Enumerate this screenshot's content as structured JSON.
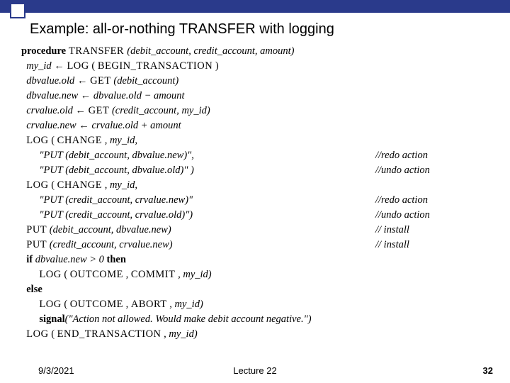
{
  "title": "Example: all-or-nothing TRANSFER with logging",
  "footer": {
    "date": "9/3/2021",
    "lecture": "Lecture 22",
    "page": "32"
  },
  "code": {
    "l1_a": "procedure",
    "l1_b": " TRANSFER ",
    "l1_c": "(debit_account, credit_account, amount)",
    "l2_a": "  my_id",
    "l2_b": " ← ",
    "l2_c": "LOG",
    "l2_d": " ( ",
    "l2_e": "BEGIN_TRANSACTION",
    "l2_f": " )",
    "l3_a": "  dbvalue.old",
    "l3_b": " ← ",
    "l3_c": "GET",
    "l3_d": " (debit_account)",
    "l4_a": "  dbvalue.new",
    "l4_b": " ← ",
    "l4_c": "dbvalue.old − amount",
    "l5_a": "  crvalue.old",
    "l5_b": " ← ",
    "l5_c": "GET",
    "l5_d": " (credit_account, my_id)",
    "l6_a": "  crvalue.new",
    "l6_b": " ← ",
    "l6_c": "crvalue.old + amount",
    "l7_a": "  ",
    "l7_b": "LOG",
    "l7_c": " ( ",
    "l7_d": "CHANGE",
    "l7_e": " , my_id,",
    "l8_l": "       \"PUT (debit_account, dbvalue.new)\",",
    "l8_r": "//redo action",
    "l9_l": "       \"PUT (debit_account, dbvalue.old)\" )",
    "l9_r": "//undo action",
    "l10_a": "  ",
    "l10_b": "LOG",
    "l10_c": " ( ",
    "l10_d": "CHANGE",
    "l10_e": " , my_id,",
    "l11_l": "       \"PUT (credit_account, crvalue.new)\"",
    "l11_r": "//redo action",
    "l12_l": "       \"PUT (credit_account, crvalue.old)\")",
    "l12_r": "//undo action",
    "l13_a": "  ",
    "l13_b": "PUT",
    "l13_c": " (debit_account, dbvalue.new)",
    "l13_r": "// install",
    "l14_a": "  ",
    "l14_b": "PUT",
    "l14_c": " (credit_account, crvalue.new)",
    "l14_r": "// install",
    "l15_a": "  ",
    "l15_b": "if",
    "l15_c": " dbvalue.new > 0 ",
    "l15_d": "then",
    "l16_a": "       ",
    "l16_b": "LOG",
    "l16_c": " ( ",
    "l16_d": "OUTCOME",
    "l16_e": " , ",
    "l16_f": "COMMIT",
    "l16_g": " , my_id)",
    "l17_a": "  ",
    "l17_b": "else",
    "l18_a": "       ",
    "l18_b": "LOG",
    "l18_c": " ( ",
    "l18_d": "OUTCOME",
    "l18_e": " , ",
    "l18_f": "ABORT",
    "l18_g": " , my_id)",
    "l19_a": "       ",
    "l19_b": "signal",
    "l19_c": "(\"Action not allowed. Would make debit account negative.\")",
    "l20_a": "  ",
    "l20_b": "LOG",
    "l20_c": " ( ",
    "l20_d": "END_TRANSACTION",
    "l20_e": " , my_id)"
  }
}
